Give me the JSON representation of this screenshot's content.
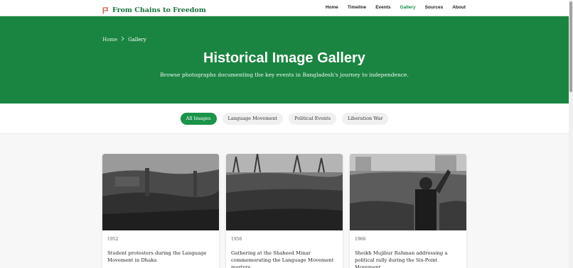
{
  "header": {
    "site_title": "From Chains to Freedom",
    "logo_icon": "flag-icon",
    "nav": [
      "Home",
      "Timeline",
      "Events",
      "Gallery",
      "Sources",
      "About"
    ],
    "active_nav": "Gallery"
  },
  "hero": {
    "breadcrumb": {
      "home": "Home",
      "current": "Gallery"
    },
    "title": "Historical Image Gallery",
    "subtitle": "Browse photographs documenting the key events in Bangladesh's journey to independence."
  },
  "filters": {
    "items": [
      "All Images",
      "Language Movement",
      "Political Events",
      "Liberation War"
    ],
    "active": "All Images"
  },
  "gallery": {
    "items": [
      {
        "year": "1952",
        "caption": "Student protesters during the Language Movement in Dhaka"
      },
      {
        "year": "1956",
        "caption": "Gathering at the Shaheed Minar commemorating the Language Movement martyrs"
      },
      {
        "year": "1966",
        "caption": "Sheikh Mujibur Rahman addressing a political rally during the Six-Point Movement"
      }
    ]
  },
  "colors": {
    "brand_green": "#1a8540",
    "accent_green": "#1a9448",
    "logo_red": "#c0392b"
  }
}
